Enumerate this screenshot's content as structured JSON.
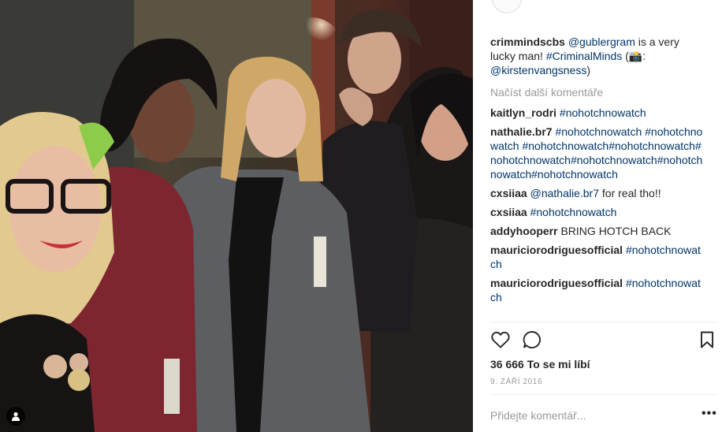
{
  "post": {
    "caption_user": "crimmindscbs",
    "caption_parts": [
      "@gublergram",
      " is a very lucky man! ",
      "#CriminalMinds",
      " (📸:",
      "@kirstenvangsness",
      ")"
    ],
    "load_more": "Načíst další komentáře",
    "comments": [
      {
        "user": "kaitlyn_rodri",
        "text": "",
        "tags": "#nohotchnowatch"
      },
      {
        "user": "nathalie.br7",
        "text": "",
        "tags": "#nohotchnowatch #nohotchnowatch #nohotchnowatch#nohotchnowatch#nohotchnowatch#nohotchnowatch#nohotchnowatch#nohotchnowatch"
      },
      {
        "user": "cxsiiaa",
        "text": " for real tho!!",
        "tags": "@nathalie.br7"
      },
      {
        "user": "cxsiiaa",
        "text": "",
        "tags": "#nohotchnowatch"
      },
      {
        "user": "addyhooperr",
        "text": "BRING HOTCH BACK",
        "tags": ""
      },
      {
        "user": "mauriciorodriguesofficial",
        "text": "",
        "tags": "#nohotchnowatch"
      },
      {
        "user": "mauriciorodriguesofficial",
        "text": "",
        "tags": "#nohotchnowatch"
      }
    ],
    "likes": "36 666 To se mi líbí",
    "date": "9. ZÁŘÍ 2016",
    "add_comment_placeholder": "Přidejte komentář...",
    "more_options": "•••"
  },
  "icons": {
    "like": "heart-icon",
    "comment": "comment-icon",
    "save": "bookmark-icon",
    "tag": "user-tag-icon"
  },
  "colors": {
    "hashtag": "#003569",
    "muted": "#999999",
    "text": "#262626"
  }
}
